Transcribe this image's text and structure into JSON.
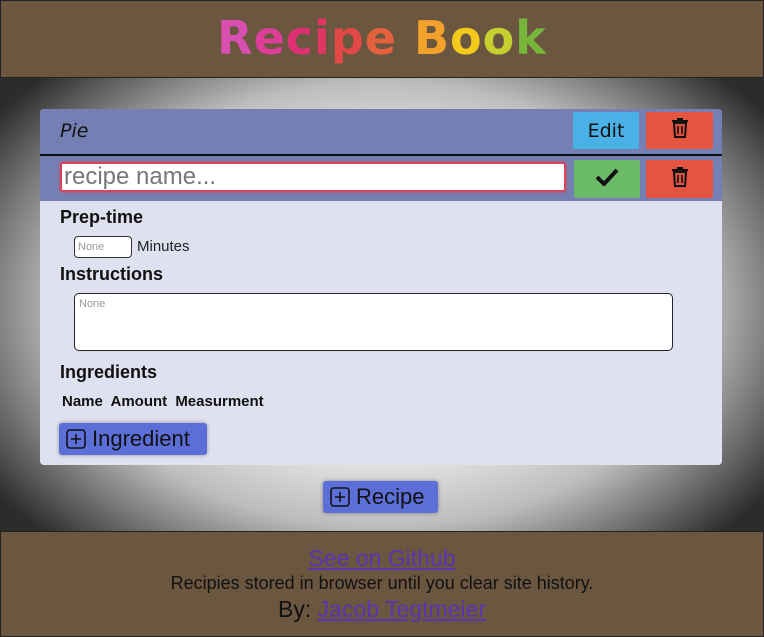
{
  "app": {
    "title": "Recipe Book",
    "title_letters": [
      {
        "ch": "R",
        "color": "#d84fb1"
      },
      {
        "ch": "e",
        "color": "#dd3f98"
      },
      {
        "ch": "c",
        "color": "#dd3174"
      },
      {
        "ch": "i",
        "color": "#e03561"
      },
      {
        "ch": "p",
        "color": "#e24846"
      },
      {
        "ch": "e",
        "color": "#e3623d"
      },
      {
        "ch": " ",
        "color": "#000000"
      },
      {
        "ch": "B",
        "color": "#f2a12a"
      },
      {
        "ch": "o",
        "color": "#f3c91c"
      },
      {
        "ch": "o",
        "color": "#c5cf2f"
      },
      {
        "ch": "k",
        "color": "#78b53b"
      }
    ]
  },
  "recipe": {
    "name": "Pie",
    "edit_label": "Edit",
    "name_input_placeholder": "recipe name...",
    "prep_time_label": "Prep-time",
    "prep_time_placeholder": "None",
    "minutes_label": "Minutes",
    "instructions_label": "Instructions",
    "instructions_placeholder": "None",
    "ingredients_label": "Ingredients",
    "ingredient_columns": [
      "Name",
      "Amount",
      "Measurment"
    ],
    "add_ingredient_label": "Ingredient"
  },
  "add_recipe_label": "Recipe",
  "footer": {
    "github_link": "See on Github",
    "note": "Recipies stored in browser until you clear site history.",
    "by_prefix": "By:",
    "author": "Jacob Tegtmeier"
  },
  "colors": {
    "header_bg": "#6b5640",
    "card_head": "#7480b3",
    "card_body": "#dfe1f0",
    "edit_button": "#4ab1e6",
    "delete_button": "#e35441",
    "confirm_button": "#6bba68",
    "add_button": "#5c6fd9",
    "link": "#5b33b3"
  },
  "icons": [
    "trash-icon",
    "check-icon",
    "plus-square-icon"
  ]
}
